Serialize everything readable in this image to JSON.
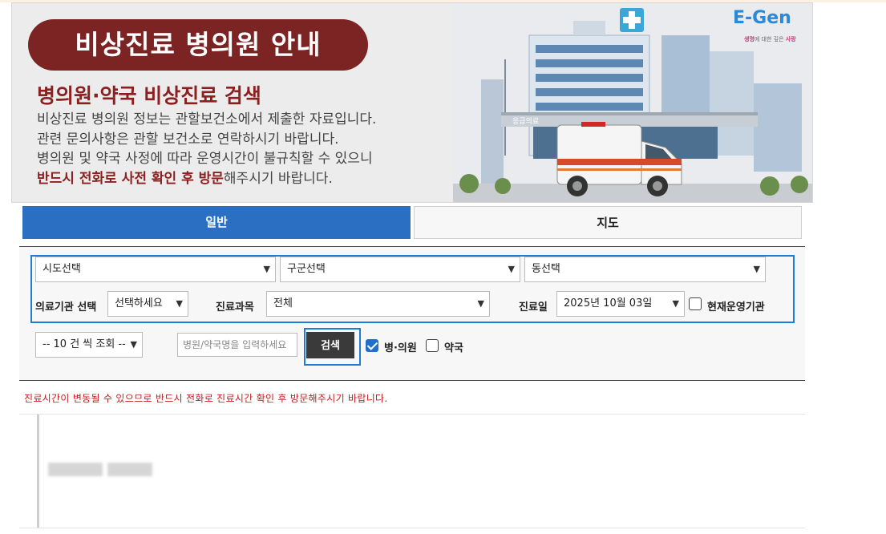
{
  "banner": {
    "title": "비상진료 병의원 안내",
    "subtitle": "병의원·약국 비상진료 검색",
    "lines": [
      "비상진료 병의원 정보는 관할보건소에서 제출한 자료입니다.",
      "관련 문의사항은 관할 보건소로 연락하시기 바랍니다.",
      "병의원 및 약국 사정에 따라 운영시간이 불규칙할 수 있으니"
    ],
    "line4_strong": "반드시 전화로 사전 확인 후 방문",
    "line4_rest": "해주시기 바랍니다.",
    "logo_text": "E-Gen",
    "logo_tagline_a": "생명",
    "logo_tagline_b": "에 대한 깊은 ",
    "logo_tagline_c": "사랑",
    "building_sign": "응급의료"
  },
  "tabs": [
    {
      "label": "일반",
      "active": true
    },
    {
      "label": "지도",
      "active": false
    }
  ],
  "filters": {
    "sido": "시도선택",
    "gugun": "구군선택",
    "dong": "동선택",
    "inst_label": "의료기관 선택",
    "inst_value": "선택하세요",
    "dept_label": "진료과목",
    "dept_value": "전체",
    "date_label": "진료일",
    "date_value": "2025년 10월 03일",
    "open_now_label": "현재운영기관",
    "open_now_checked": false
  },
  "query": {
    "page_size": "-- 10 건 씩 조회 --",
    "search_placeholder": "병원/약국명을 입력하세요",
    "search_button": "검색",
    "hospital_label": "병·의원",
    "hospital_checked": true,
    "pharmacy_label": "약국",
    "pharmacy_checked": false
  },
  "notice": "진료시간이 변동될 수 있으므로 반드시 전화로 진료시간 확인 후 방문해주시기 바랍니다.",
  "colors": {
    "accent_blue": "#2a6fc1",
    "banner_pill": "#7c2324",
    "notice_red": "#c41b1b"
  }
}
